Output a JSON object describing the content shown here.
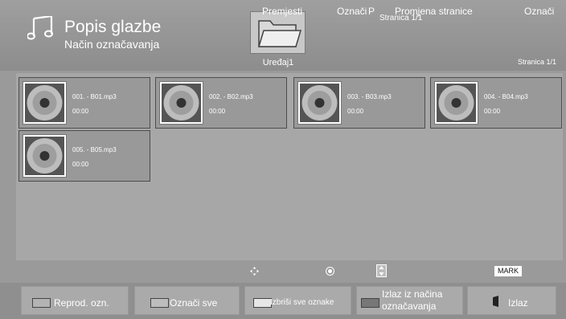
{
  "header": {
    "title": "Popis glazbe",
    "subtitle": "Način označavanja",
    "device": "Uređaj1",
    "page_top": "Stranica 1/1",
    "page_right": "Stranica 1/1"
  },
  "files": [
    {
      "name": "001. - B01.mp3",
      "time": "00:00"
    },
    {
      "name": "002. - B02.mp3",
      "time": "00:00"
    },
    {
      "name": "003. - B03.mp3",
      "time": "00:00"
    },
    {
      "name": "004. - B04.mp3",
      "time": "00:00"
    },
    {
      "name": "005. - B05.mp3",
      "time": "00:00"
    }
  ],
  "hints": {
    "move": "Premjesti",
    "ok": "Označi",
    "p": "P",
    "page_change": "Promjena stranice",
    "mark_key": "MARK",
    "mark": "Označi"
  },
  "buttons": {
    "play_marked": "Reprod. ozn.",
    "mark_all": "Označi sve",
    "unmark_all": "Izbriši sve oznake",
    "exit_mark_line1": "Izlaz iz načina",
    "exit_mark_line2": "označavanja",
    "exit": "Izlaz"
  },
  "colors": {
    "red_key": "#b3b3b3",
    "green_key": "#bdbdbd",
    "yellow_key": "#e6e6e6",
    "blue_key": "#777777"
  },
  "icons": {
    "header": "music-note-icon",
    "device": "folder-icon",
    "file": "cd-disc-icon",
    "exit": "exit-door-icon"
  }
}
